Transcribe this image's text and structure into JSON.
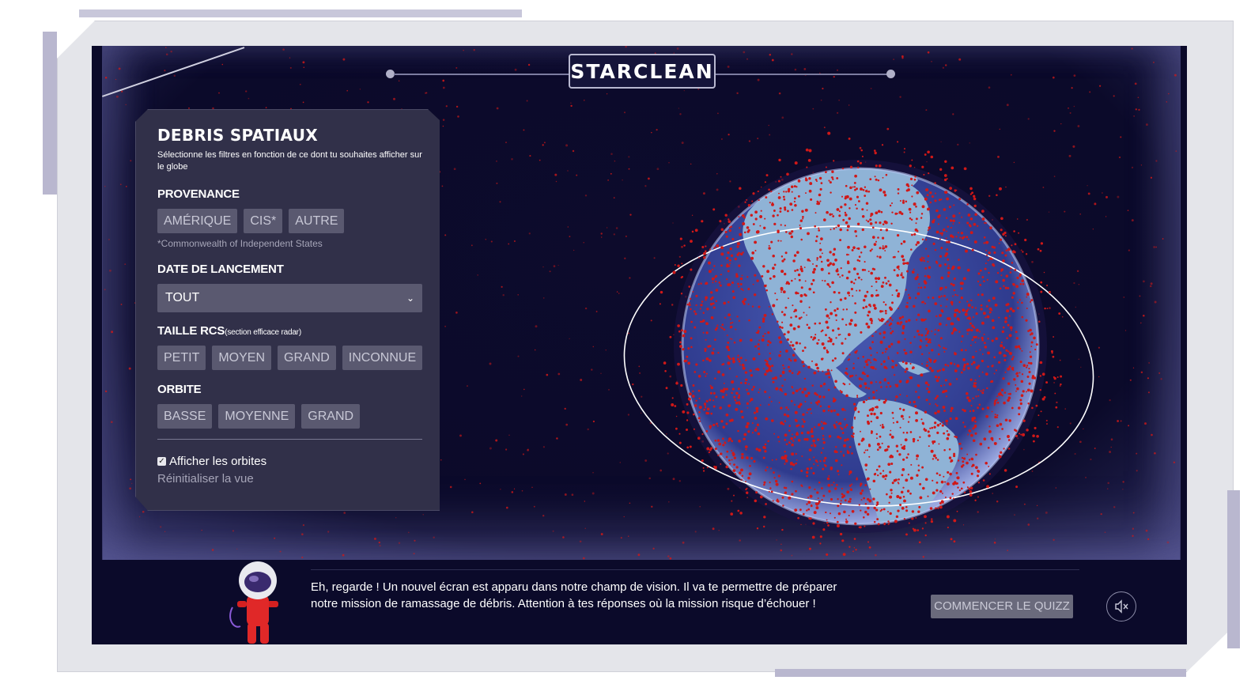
{
  "logo": {
    "text": "STARCLEAN"
  },
  "panel": {
    "title": "DEBRIS SPATIAUX",
    "intro": "Sélectionne les filtres en fonction de ce dont tu souhaites afficher sur le globe",
    "provenance": {
      "label": "PROVENANCE",
      "options": [
        "AMÉRIQUE",
        "CIS*",
        "AUTRE"
      ],
      "note": "*Commonwealth of Independent States"
    },
    "date": {
      "label": "DATE DE LANCEMENT",
      "selected": "TOUT"
    },
    "taille": {
      "label": "TAILLE RCS",
      "sublabel": "(section efficace radar)",
      "options": [
        "PETIT",
        "MOYEN",
        "GRAND",
        "INCONNUE"
      ]
    },
    "orbite": {
      "label": "ORBITE",
      "options": [
        "BASSE",
        "MOYENNE",
        "GRAND"
      ]
    },
    "show_orbits": {
      "label": "Afficher les orbites",
      "checked": true
    },
    "reset_label": "Réinitialiser la vue"
  },
  "dialog": {
    "text": "Eh, regarde ! Un nouvel écran est apparu dans notre champ de vision. Il va te permettre de préparer notre mission de ramassage de débris. Attention à tes réponses où la mission risque d’échouer !"
  },
  "quiz_button": "COMMENCER LE QUIZZ",
  "icons": {
    "mute": "mute-speaker-icon",
    "mascot": "astronaut-icon",
    "globe": "earth-globe-icon"
  },
  "colors": {
    "debris": "#d01818",
    "screen": "#0b0a2a",
    "ocean": "#3a4a9e",
    "land": "#8fb3d6",
    "panel": "#313049"
  }
}
